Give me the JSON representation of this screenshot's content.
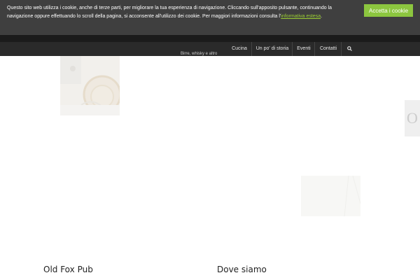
{
  "cookie_banner": {
    "text": "Questo sito web utilizza i cookie, anche di terze parti, per migliorare la tua esperienza di navigazione. Cliccando sull'apposito pulsante, continuando la navigazione oppure effettuando lo scroll della pagina, si acconsente all'utilizzo dei cookie. Per maggiori informazioni consulta l'",
    "link_label": "informativa estesa",
    "suffix": ".",
    "accept_label": "Accetta i cookie"
  },
  "header": {
    "tagline": "Birre, whisky e altro",
    "nav": [
      "Cucina",
      "Un po' di storia",
      "Eventi",
      "Contatti"
    ],
    "search_icon": "search-icon"
  },
  "side_tab": {
    "glyph": "O"
  },
  "sections": {
    "left_title": "Old Fox Pub",
    "right_title": "Dove siamo"
  },
  "colors": {
    "cookie_bg": "#3f3f3f",
    "accept_bg": "#8cc63f",
    "nav_bg": "#2a2a2a"
  }
}
